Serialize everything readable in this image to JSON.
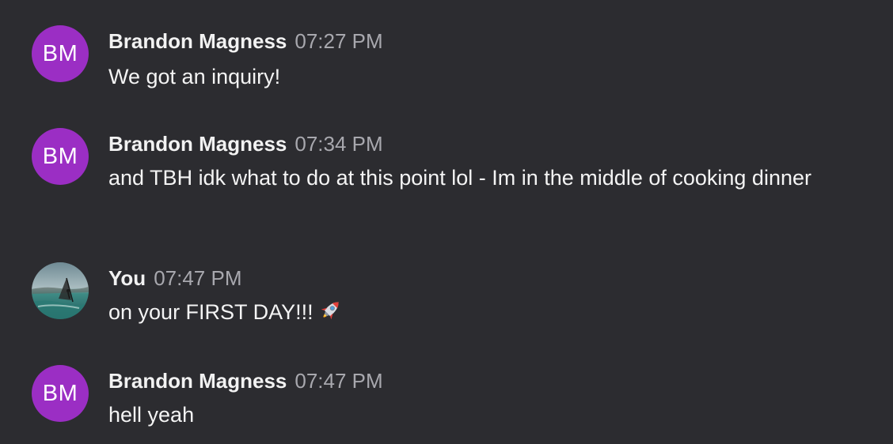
{
  "messages": [
    {
      "author": "Brandon Magness",
      "time": "07:27 PM",
      "text": "We got an inquiry!",
      "avatar": {
        "initials": "BM",
        "color": "#9b2ec4"
      }
    },
    {
      "author": "Brandon Magness",
      "time": "07:34 PM",
      "text": "and TBH idk what to do at this point lol - Im in the middle of cooking dinner",
      "avatar": {
        "initials": "BM",
        "color": "#9b2ec4"
      }
    },
    {
      "author": "You",
      "time": "07:47 PM",
      "text": "on your FIRST DAY!!!",
      "emoji": "rocket",
      "avatar": {
        "type": "photo",
        "icon": "windsurfer-photo"
      }
    },
    {
      "author": "Brandon Magness",
      "time": "07:47 PM",
      "text": "hell yeah",
      "avatar": {
        "initials": "BM",
        "color": "#9b2ec4"
      }
    }
  ],
  "colors": {
    "background": "#2c2c30",
    "author": "#f2f2f2",
    "timestamp": "#a8a8ae",
    "body_text": "#f4f4f4"
  }
}
